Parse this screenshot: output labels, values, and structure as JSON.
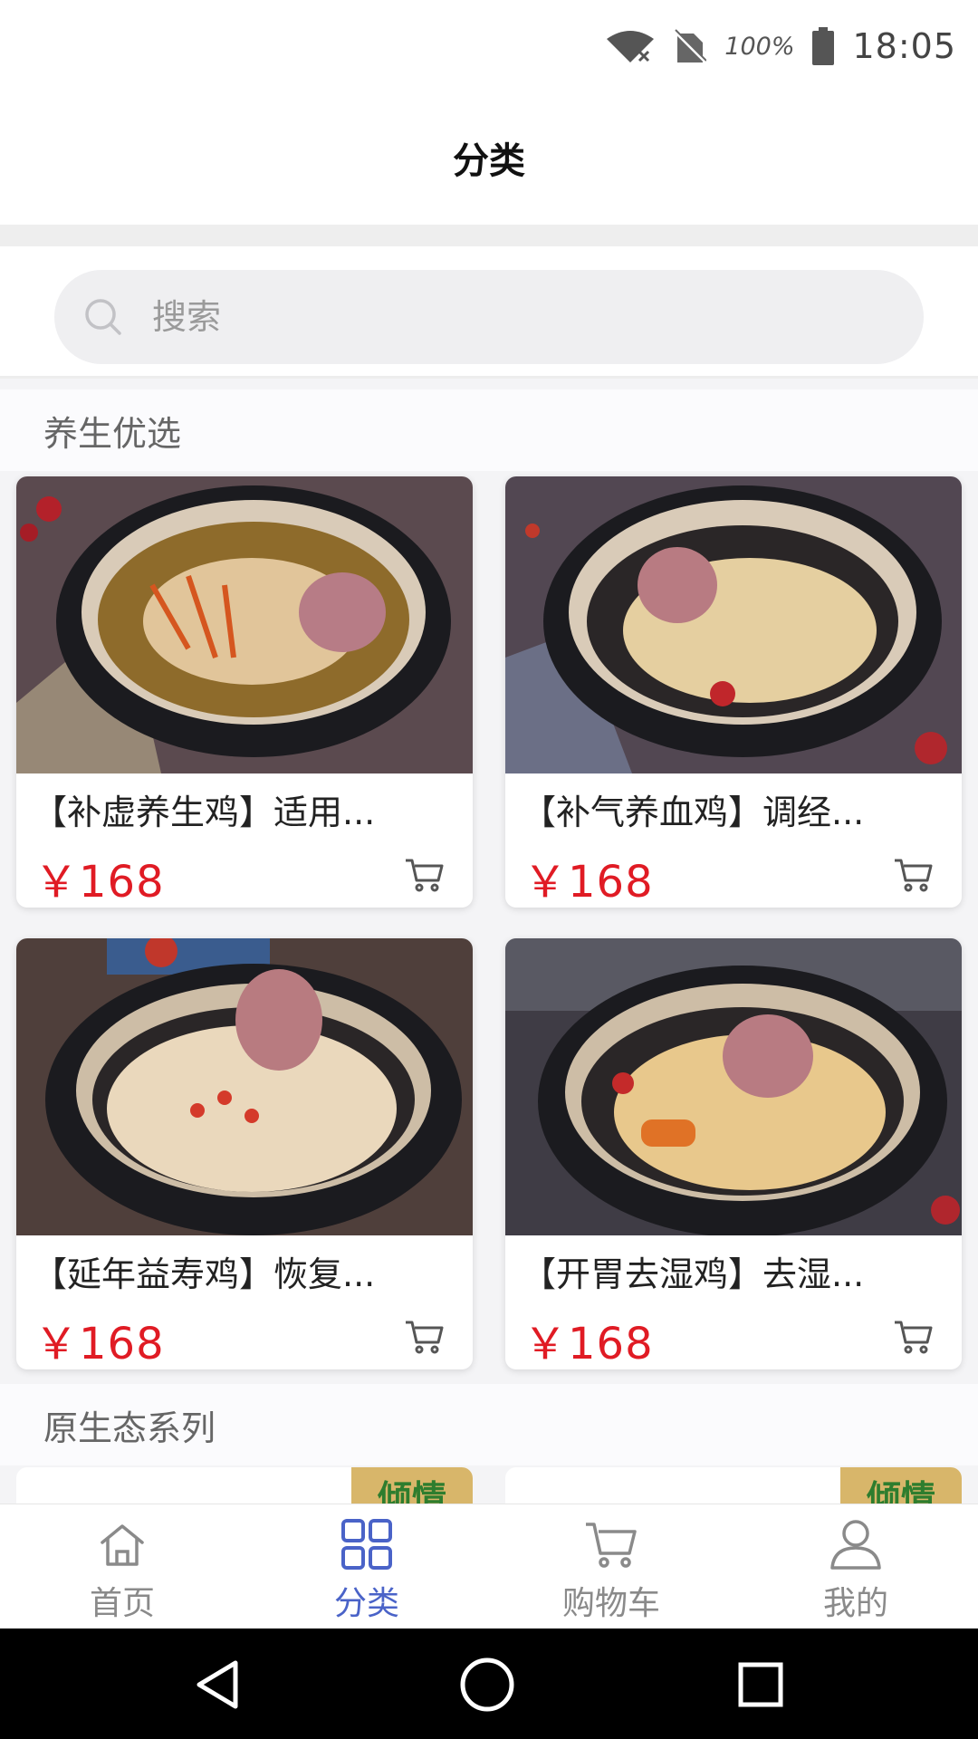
{
  "status": {
    "battery_pct": "100%",
    "time": "18:05"
  },
  "header": {
    "title": "分类"
  },
  "search": {
    "placeholder": "搜索"
  },
  "sections": [
    {
      "title": "养生优选",
      "products": [
        {
          "title": "【补虚养生鸡】适用...",
          "price": "￥168",
          "image": "chicken-soup-pot-1"
        },
        {
          "title": "【补气养血鸡】调经...",
          "price": "￥168",
          "image": "chicken-soup-pot-2"
        },
        {
          "title": "【延年益寿鸡】恢复...",
          "price": "￥168",
          "image": "chicken-soup-pot-3"
        },
        {
          "title": "【开胃去湿鸡】去湿...",
          "price": "￥168",
          "image": "chicken-soup-pot-4"
        }
      ]
    },
    {
      "title": "原生态系列",
      "partial_tag": "倾情"
    }
  ],
  "tabbar": {
    "items": [
      {
        "label": "首页",
        "icon": "home-icon",
        "active": false
      },
      {
        "label": "分类",
        "icon": "grid-icon",
        "active": true
      },
      {
        "label": "购物车",
        "icon": "cart-icon",
        "active": false
      },
      {
        "label": "我的",
        "icon": "user-icon",
        "active": false
      }
    ]
  },
  "colors": {
    "price": "#e01b24",
    "tab_active": "#4a63c8",
    "tab_inactive": "#8a8a8a"
  }
}
